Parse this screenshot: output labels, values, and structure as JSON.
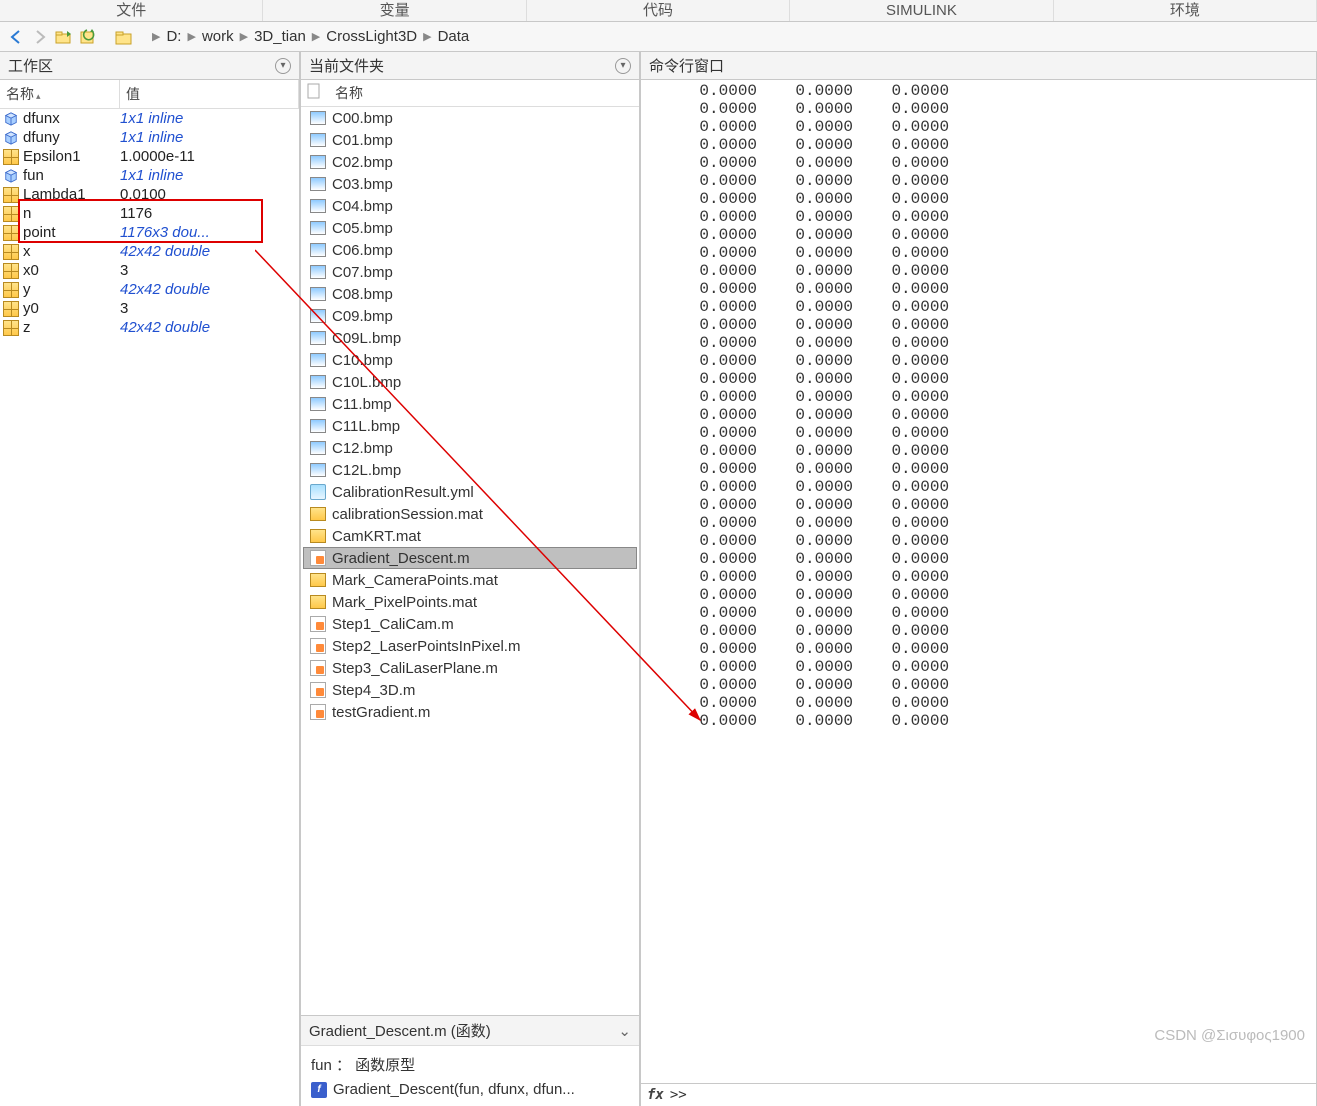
{
  "tabs": [
    "文件",
    "变量",
    "代码",
    "SIMULINK",
    "环境"
  ],
  "breadcrumb": [
    "D:",
    "work",
    "3D_tian",
    "CrossLight3D",
    "Data"
  ],
  "workspace": {
    "title": "工作区",
    "col_name": "名称",
    "col_value": "值",
    "rows": [
      {
        "icon": "cube",
        "name": "dfunx",
        "val": "1x1 inline",
        "cls": "link"
      },
      {
        "icon": "cube",
        "name": "dfuny",
        "val": "1x1 inline",
        "cls": "link"
      },
      {
        "icon": "matrix",
        "name": "Epsilon1",
        "val": "1.0000e-11",
        "cls": ""
      },
      {
        "icon": "cube",
        "name": "fun",
        "val": "1x1 inline",
        "cls": "link"
      },
      {
        "icon": "matrix",
        "name": "Lambda1",
        "val": "0.0100",
        "cls": ""
      },
      {
        "icon": "matrix",
        "name": "n",
        "val": "1176",
        "cls": ""
      },
      {
        "icon": "matrix",
        "name": "point",
        "val": "1176x3 dou...",
        "cls": "double"
      },
      {
        "icon": "matrix",
        "name": "x",
        "val": "42x42 double",
        "cls": "double"
      },
      {
        "icon": "matrix",
        "name": "x0",
        "val": "3",
        "cls": ""
      },
      {
        "icon": "matrix",
        "name": "y",
        "val": "42x42 double",
        "cls": "double"
      },
      {
        "icon": "matrix",
        "name": "y0",
        "val": "3",
        "cls": ""
      },
      {
        "icon": "matrix",
        "name": "z",
        "val": "42x42 double",
        "cls": "double"
      }
    ]
  },
  "folder": {
    "title": "当前文件夹",
    "col_name": "名称",
    "files": [
      {
        "icon": "bmp",
        "name": "C00.bmp"
      },
      {
        "icon": "bmp",
        "name": "C01.bmp"
      },
      {
        "icon": "bmp",
        "name": "C02.bmp"
      },
      {
        "icon": "bmp",
        "name": "C03.bmp"
      },
      {
        "icon": "bmp",
        "name": "C04.bmp"
      },
      {
        "icon": "bmp",
        "name": "C05.bmp"
      },
      {
        "icon": "bmp",
        "name": "C06.bmp"
      },
      {
        "icon": "bmp",
        "name": "C07.bmp"
      },
      {
        "icon": "bmp",
        "name": "C08.bmp"
      },
      {
        "icon": "bmp",
        "name": "C09.bmp"
      },
      {
        "icon": "bmp",
        "name": "C09L.bmp"
      },
      {
        "icon": "bmp",
        "name": "C10.bmp"
      },
      {
        "icon": "bmp",
        "name": "C10L.bmp"
      },
      {
        "icon": "bmp",
        "name": "C11.bmp"
      },
      {
        "icon": "bmp",
        "name": "C11L.bmp"
      },
      {
        "icon": "bmp",
        "name": "C12.bmp"
      },
      {
        "icon": "bmp",
        "name": "C12L.bmp"
      },
      {
        "icon": "yml",
        "name": "CalibrationResult.yml"
      },
      {
        "icon": "mat",
        "name": "calibrationSession.mat"
      },
      {
        "icon": "mat",
        "name": "CamKRT.mat"
      },
      {
        "icon": "m",
        "name": "Gradient_Descent.m",
        "selected": true
      },
      {
        "icon": "mat",
        "name": "Mark_CameraPoints.mat"
      },
      {
        "icon": "mat",
        "name": "Mark_PixelPoints.mat"
      },
      {
        "icon": "m",
        "name": "Step1_CaliCam.m"
      },
      {
        "icon": "m",
        "name": "Step2_LaserPointsInPixel.m"
      },
      {
        "icon": "m",
        "name": "Step3_CaliLaserPlane.m"
      },
      {
        "icon": "m",
        "name": "Step4_3D.m"
      },
      {
        "icon": "m",
        "name": "testGradient.m"
      }
    ]
  },
  "details": {
    "header": "Gradient_Descent.m  (函数)",
    "line1": "fun ： 函数原型",
    "line2": "Gradient_Descent(fun, dfunx, dfun..."
  },
  "cmd": {
    "title": "命令行窗口",
    "value": "0.0000",
    "rows": 36,
    "prompt": ">>"
  },
  "watermark": "CSDN @Σισυφος1900"
}
